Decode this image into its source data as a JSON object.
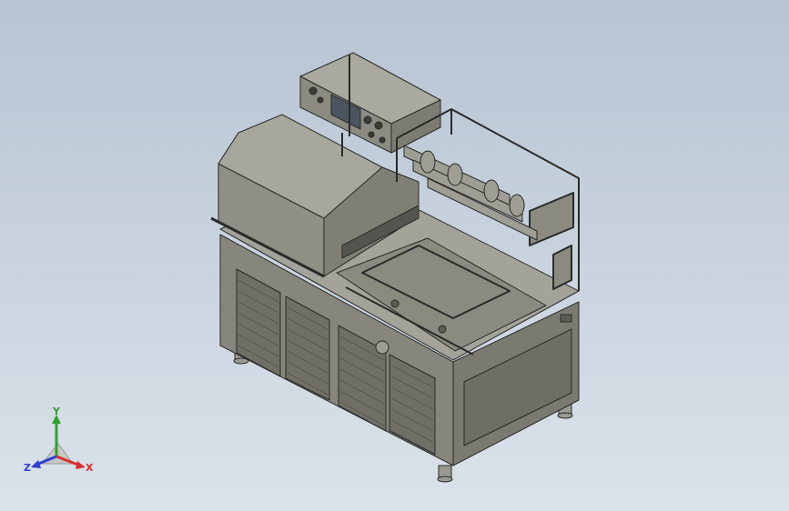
{
  "scene": {
    "background_top": "#b7c4d3",
    "background_bottom": "#dbe2ea",
    "model_color": "#8d8d82",
    "edge_color": "#2a2a2a"
  },
  "triad": {
    "x_label": "X",
    "y_label": "Y",
    "z_label": "Z",
    "x_color": "#d93030",
    "y_color": "#2fa02f",
    "z_color": "#2f3fd0"
  }
}
